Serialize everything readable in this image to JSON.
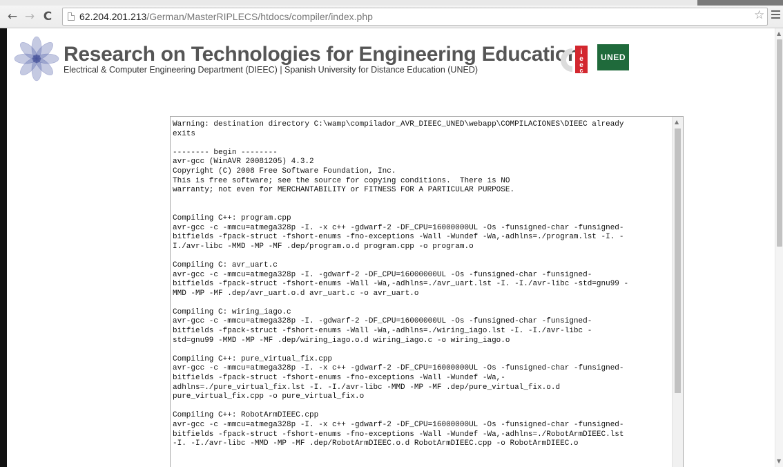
{
  "browser": {
    "url_host": "62.204.201.213",
    "url_path": "/German/MasterRIPLECS/htdocs/compiler/index.php",
    "back_icon": "back-arrow-icon",
    "forward_icon": "forward-arrow-icon",
    "reload_icon": "reload-icon",
    "bookmark_icon": "star-icon",
    "menu_icon": "hamburger-menu-icon"
  },
  "header": {
    "title": "Research on Technologies for Engineering Education",
    "subtitle": "Electrical & Computer Engineering Department (DIEEC) | Spanish University for Distance Education (UNED)",
    "uned_logo_text": "UNED",
    "colors": {
      "title": "#555555",
      "uned_green": "#1f6a3b",
      "ieec_red": "#d3272f"
    }
  },
  "console": {
    "lines": [
      "Warning: destination directory C:\\wamp\\compilador_AVR_DIEEC_UNED\\webapp\\COMPILACIONES\\DIEEC already",
      "exits",
      "",
      "-------- begin --------",
      "avr-gcc (WinAVR 20081205) 4.3.2",
      "Copyright (C) 2008 Free Software Foundation, Inc.",
      "This is free software; see the source for copying conditions.  There is NO",
      "warranty; not even for MERCHANTABILITY or FITNESS FOR A PARTICULAR PURPOSE.",
      "",
      "",
      "Compiling C++: program.cpp",
      "avr-gcc -c -mmcu=atmega328p -I. -x c++ -gdwarf-2 -DF_CPU=16000000UL -Os -funsigned-char -funsigned-",
      "bitfields -fpack-struct -fshort-enums -fno-exceptions -Wall -Wundef -Wa,-adhlns=./program.lst -I. -",
      "I./avr-libc -MMD -MP -MF .dep/program.o.d program.cpp -o program.o",
      "",
      "Compiling C: avr_uart.c",
      "avr-gcc -c -mmcu=atmega328p -I. -gdwarf-2 -DF_CPU=16000000UL -Os -funsigned-char -funsigned-",
      "bitfields -fpack-struct -fshort-enums -Wall -Wa,-adhlns=./avr_uart.lst -I. -I./avr-libc -std=gnu99 -",
      "MMD -MP -MF .dep/avr_uart.o.d avr_uart.c -o avr_uart.o",
      "",
      "Compiling C: wiring_iago.c",
      "avr-gcc -c -mmcu=atmega328p -I. -gdwarf-2 -DF_CPU=16000000UL -Os -funsigned-char -funsigned-",
      "bitfields -fpack-struct -fshort-enums -Wall -Wa,-adhlns=./wiring_iago.lst -I. -I./avr-libc -",
      "std=gnu99 -MMD -MP -MF .dep/wiring_iago.o.d wiring_iago.c -o wiring_iago.o",
      "",
      "Compiling C++: pure_virtual_fix.cpp",
      "avr-gcc -c -mmcu=atmega328p -I. -x c++ -gdwarf-2 -DF_CPU=16000000UL -Os -funsigned-char -funsigned-",
      "bitfields -fpack-struct -fshort-enums -fno-exceptions -Wall -Wundef -Wa,-",
      "adhlns=./pure_virtual_fix.lst -I. -I./avr-libc -MMD -MP -MF .dep/pure_virtual_fix.o.d",
      "pure_virtual_fix.cpp -o pure_virtual_fix.o",
      "",
      "Compiling C++: RobotArmDIEEC.cpp",
      "avr-gcc -c -mmcu=atmega328p -I. -x c++ -gdwarf-2 -DF_CPU=16000000UL -Os -funsigned-char -funsigned-",
      "bitfields -fpack-struct -fshort-enums -fno-exceptions -Wall -Wundef -Wa,-adhlns=./RobotArmDIEEC.lst",
      "-I. -I./avr-libc -MMD -MP -MF .dep/RobotArmDIEEC.o.d RobotArmDIEEC.cpp -o RobotArmDIEEC.o"
    ]
  }
}
